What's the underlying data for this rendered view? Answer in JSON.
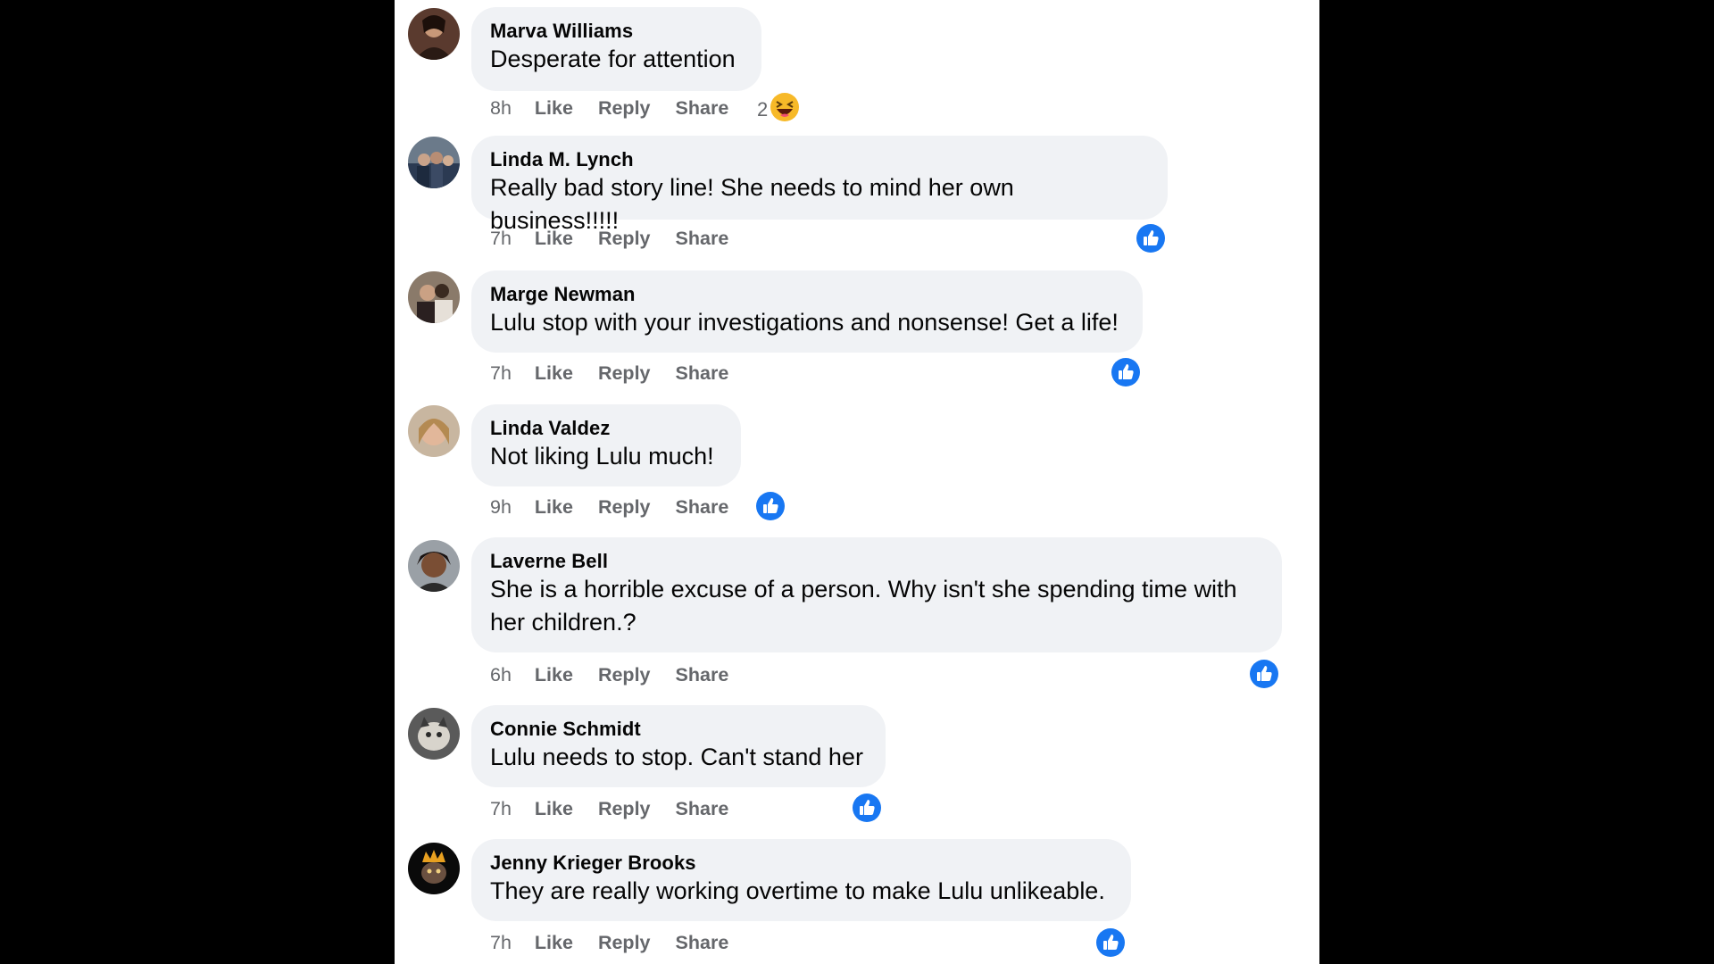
{
  "colors": {
    "bubble_bg": "#f0f2f5",
    "meta_text": "#65676b",
    "like_blue": "#1877f2",
    "haha_yellow": "#f7b928"
  },
  "comments": [
    {
      "author": "Marva Williams",
      "text": "Desperate for attention",
      "time": "8h",
      "like": "Like",
      "reply": "Reply",
      "share": "Share",
      "reaction": "haha-icon",
      "reaction_count": "2"
    },
    {
      "author": "Linda M. Lynch",
      "text": "Really bad story line! She needs to mind her own business!!!!!",
      "time": "7h",
      "like": "Like",
      "reply": "Reply",
      "share": "Share",
      "reaction": "like-icon"
    },
    {
      "author": "Marge Newman",
      "text": "Lulu stop with your investigations and nonsense! Get a life!",
      "time": "7h",
      "like": "Like",
      "reply": "Reply",
      "share": "Share",
      "reaction": "like-icon"
    },
    {
      "author": "Linda Valdez",
      "text": "Not liking Lulu much!",
      "time": "9h",
      "like": "Like",
      "reply": "Reply",
      "share": "Share",
      "reaction": "like-icon"
    },
    {
      "author": "Laverne Bell",
      "text": "She is a horrible excuse of a person. Why isn't she spending time with her children.?",
      "time": "6h",
      "like": "Like",
      "reply": "Reply",
      "share": "Share",
      "reaction": "like-icon"
    },
    {
      "author": "Connie Schmidt",
      "text": "Lulu needs to stop. Can't stand her",
      "time": "7h",
      "like": "Like",
      "reply": "Reply",
      "share": "Share",
      "reaction": "like-icon"
    },
    {
      "author": "Jenny Krieger Brooks",
      "text": "They are really working overtime to make Lulu unlikeable.",
      "time": "7h",
      "like": "Like",
      "reply": "Reply",
      "share": "Share",
      "reaction": "like-icon"
    }
  ]
}
